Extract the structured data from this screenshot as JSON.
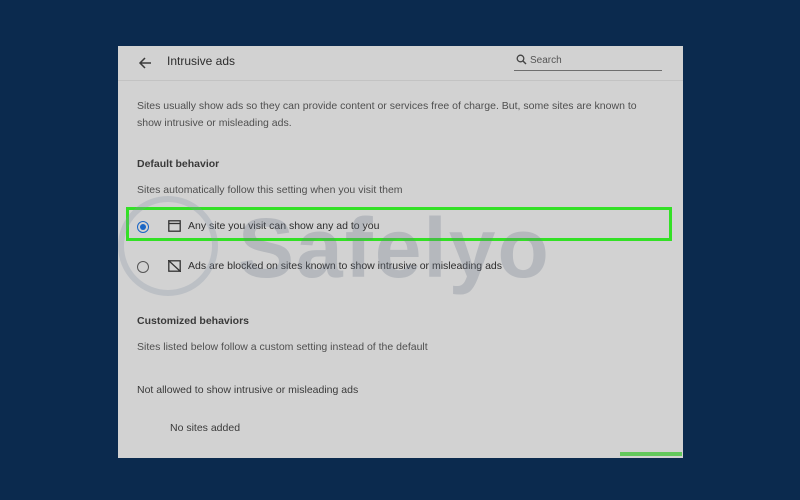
{
  "header": {
    "title": "Intrusive ads",
    "back_icon": "arrow-left-icon",
    "search_placeholder": "Search",
    "search_icon": "search-icon"
  },
  "description": "Sites usually show ads so they can provide content or services free of charge. But, some sites are known to show intrusive or misleading ads.",
  "default_behavior": {
    "heading": "Default behavior",
    "subtext": "Sites automatically follow this setting when you visit them",
    "options": [
      {
        "label": "Any site you visit can show any ad to you",
        "icon": "window-icon",
        "checked": true
      },
      {
        "label": "Ads are blocked on sites known to show intrusive or misleading ads",
        "icon": "ads-blocked-icon",
        "checked": false
      }
    ]
  },
  "customized_behaviors": {
    "heading": "Customized behaviors",
    "subtext": "Sites listed below follow a custom setting instead of the default",
    "not_allowed_heading": "Not allowed to show intrusive or misleading ads",
    "empty_text": "No sites added"
  },
  "watermark": {
    "text": "Safelyo"
  },
  "colors": {
    "accent": "#1a66c5",
    "highlight": "#33e026",
    "background": "#0b2a4e",
    "panel": "#d2d2d2"
  }
}
